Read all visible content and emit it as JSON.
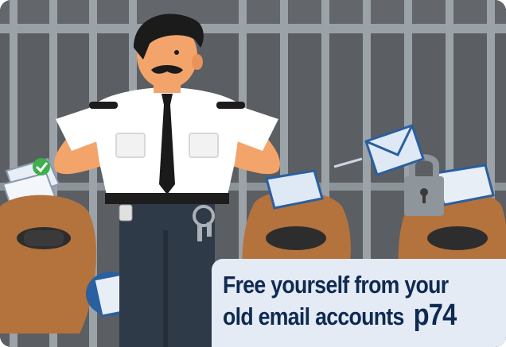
{
  "caption": {
    "line1": "Free yourself from your",
    "line2": "old email accounts",
    "page_ref": "p74"
  },
  "colors": {
    "background": "#5a5d60",
    "bars": "#9ca3a8",
    "caption_bg": "#e4ebf5",
    "caption_text": "#0f2a52",
    "sack": "#b4723c",
    "envelope": "#dfe9f5"
  },
  "icons": [
    "prison-bars",
    "guard",
    "money-sack",
    "envelope-icon",
    "padlock-icon",
    "checkmark-icon",
    "keyring-icon"
  ]
}
